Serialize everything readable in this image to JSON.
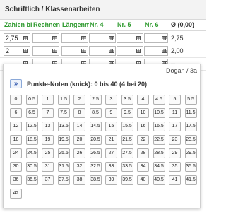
{
  "section": {
    "title": "Schriftlich / Klassenarbeiten"
  },
  "columns": [
    "Zahlen bis",
    "Rechnen m",
    "Längenmaße",
    "Nr. 4",
    "Nr. 5",
    "Nr. 6",
    "Ø (0,00)"
  ],
  "rows": [
    {
      "first_value": "2,75",
      "average": "2,75"
    },
    {
      "first_value": "2",
      "average": "2,00"
    },
    {
      "first_value": "",
      "average": "--"
    }
  ],
  "popup": {
    "student": "Dogan / 3a",
    "expand_label": "»",
    "title": "Punkte-Noten (knick): 0 bis 40 (4 bei 20)",
    "keys": [
      [
        "0",
        "0.5",
        "1",
        "1.5",
        "2",
        "2.5",
        "3",
        "3.5",
        "4",
        "4.5",
        "5",
        "5.5"
      ],
      [
        "6",
        "6.5",
        "7",
        "7.5",
        "8",
        "8.5",
        "9",
        "9.5",
        "10",
        "10.5",
        "11",
        "11.5"
      ],
      [
        "12",
        "12.5",
        "13",
        "13.5",
        "14",
        "14.5",
        "15",
        "15.5",
        "16",
        "16.5",
        "17",
        "17.5"
      ],
      [
        "18",
        "18.5",
        "19",
        "19.5",
        "20",
        "20.5",
        "21",
        "21.5",
        "22",
        "22.5",
        "23",
        "23.5"
      ],
      [
        "24",
        "24.5",
        "25",
        "25.5",
        "26",
        "26.5",
        "27",
        "27.5",
        "28",
        "28.5",
        "29",
        "29.5"
      ],
      [
        "30",
        "30.5",
        "31",
        "31.5",
        "32",
        "32.5",
        "33",
        "33.5",
        "34",
        "34.5",
        "35",
        "35.5"
      ],
      [
        "36",
        "36.5",
        "37",
        "37.5",
        "38",
        "38.5",
        "39",
        "39.5",
        "40",
        "40.5",
        "41",
        "41.5"
      ],
      [
        "42"
      ]
    ]
  }
}
